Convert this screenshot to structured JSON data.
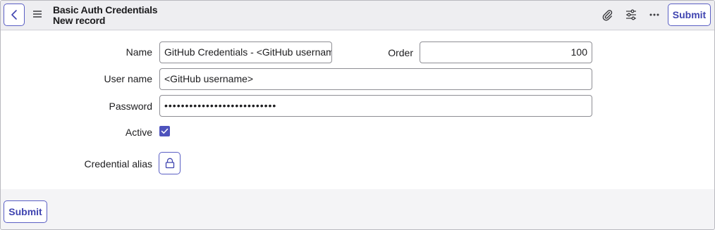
{
  "header": {
    "title": "Basic Auth Credentials",
    "subtitle": "New record",
    "submit_label": "Submit",
    "icons": [
      "back-icon",
      "menu-icon",
      "paperclip-icon",
      "sliders-icon",
      "more-icon"
    ]
  },
  "form": {
    "name": {
      "label": "Name",
      "value": "GitHub Credentials - <GitHub username>"
    },
    "order": {
      "label": "Order",
      "value": "100"
    },
    "user_name": {
      "label": "User name",
      "value": "<GitHub username>"
    },
    "password": {
      "label": "Password",
      "value": "•••••••••••••••••••••••••••"
    },
    "active": {
      "label": "Active",
      "checked": true
    },
    "credential_alias": {
      "label": "Credential alias",
      "icon": "lock-icon"
    }
  },
  "footer": {
    "submit_label": "Submit"
  },
  "colors": {
    "accent": "#4e53bd",
    "header_bg": "#eeeef1",
    "footer_bg": "#f4f4f6"
  }
}
